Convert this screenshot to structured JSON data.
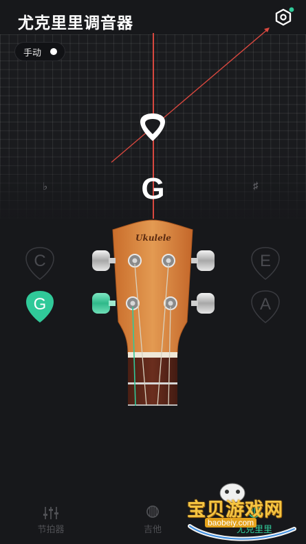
{
  "header": {
    "title": "尤克里里调音器",
    "settings_icon": "settings-hex-icon",
    "notification_dot_color": "#30c999"
  },
  "mode_toggle": {
    "label": "手动",
    "on": true
  },
  "tuner": {
    "detected_note": "G",
    "flat_symbol": "♭",
    "sharp_symbol": "♯",
    "needle_color": "#d9483f",
    "pick_icon": "guitar-pick-icon"
  },
  "strings": {
    "c": "C",
    "e": "E",
    "g": "G",
    "a": "A",
    "selected": "G",
    "accent_color": "#30c999"
  },
  "instrument": {
    "brand": "Ukulele"
  },
  "tab_bar": {
    "metronome": "节拍器",
    "guitar": "吉他",
    "ukulele": "尤克里里",
    "active": "ukulele"
  },
  "watermark": {
    "title": "宝贝游戏网",
    "url": "baobeiy.com"
  }
}
